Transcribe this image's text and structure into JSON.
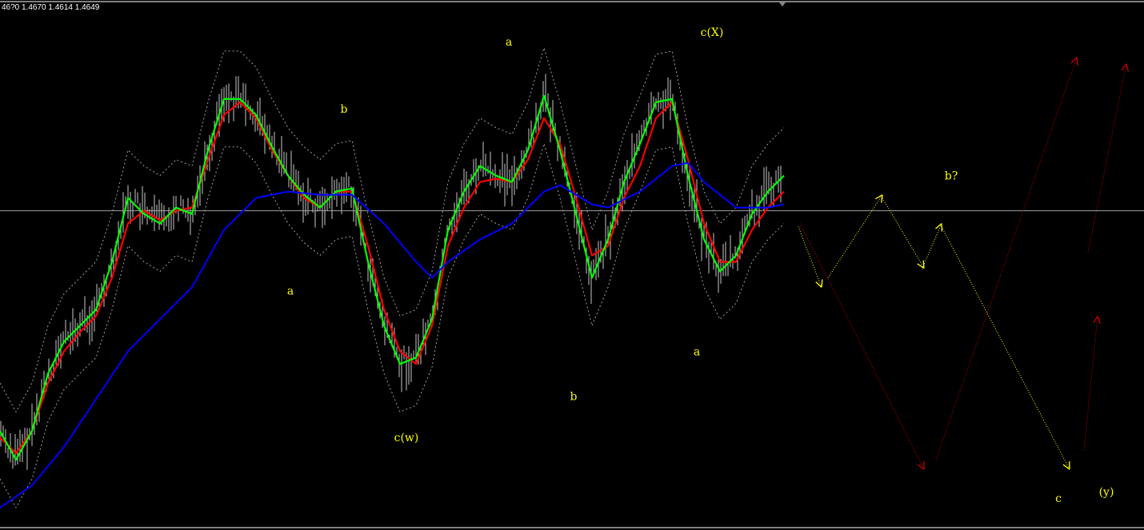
{
  "header": {
    "ohlc_text": "46?0 1.4670 1.4614 1.4649"
  },
  "colors": {
    "background": "#000000",
    "price_bars": "#c8c8c8",
    "fast_ma": "#00ff00",
    "slow_ma": "#ff0000",
    "long_ma": "#0000ff",
    "bands": "#a0a0a0",
    "bid_line": "#a0a0a0",
    "wave_yellow": "#ffff00",
    "wave_red": "#cc0000"
  },
  "chart_data": {
    "type": "line",
    "ylim": [
      1.4549,
      1.4715
    ],
    "bid_line": 1.4649,
    "x_bars": [
      0,
      2,
      4,
      6,
      8,
      10,
      12,
      14,
      16,
      18,
      20,
      22,
      24,
      26,
      28,
      30,
      32,
      34,
      36,
      38,
      40,
      42,
      44,
      46,
      48,
      50,
      52,
      54,
      56,
      58,
      60,
      62,
      64,
      66,
      68,
      70,
      72,
      74,
      76,
      78,
      80,
      82,
      84,
      86,
      88,
      90,
      92,
      94,
      96,
      98
    ],
    "series": [
      {
        "key": "fast",
        "color": "#00ff00",
        "values": [
          1.458,
          1.4571,
          1.458,
          1.4598,
          1.4608,
          1.4613,
          1.4618,
          1.4633,
          1.4653,
          1.4648,
          1.4645,
          1.465,
          1.4648,
          1.4668,
          1.4684,
          1.4684,
          1.4679,
          1.4669,
          1.466,
          1.4654,
          1.465,
          1.4655,
          1.4656,
          1.4633,
          1.4613,
          1.4601,
          1.4603,
          1.4615,
          1.4643,
          1.4655,
          1.4663,
          1.466,
          1.4658,
          1.4668,
          1.4685,
          1.4668,
          1.4648,
          1.4628,
          1.464,
          1.4658,
          1.467,
          1.4683,
          1.4684,
          1.466,
          1.464,
          1.463,
          1.4635,
          1.4648,
          1.4655,
          1.466
        ]
      },
      {
        "key": "slow",
        "color": "#ff0000",
        "values": [
          1.4578,
          1.4573,
          1.458,
          1.4595,
          1.4605,
          1.4611,
          1.4616,
          1.4628,
          1.4645,
          1.4649,
          1.4646,
          1.4649,
          1.465,
          1.4665,
          1.4679,
          1.4683,
          1.4678,
          1.4668,
          1.466,
          1.4653,
          1.465,
          1.4655,
          1.4655,
          1.4638,
          1.4618,
          1.4605,
          1.4601,
          1.4613,
          1.4638,
          1.465,
          1.4658,
          1.4659,
          1.4658,
          1.4665,
          1.4678,
          1.467,
          1.4653,
          1.4635,
          1.4638,
          1.4653,
          1.4663,
          1.4678,
          1.4683,
          1.4665,
          1.4645,
          1.4633,
          1.4633,
          1.4643,
          1.465,
          1.4655
        ]
      },
      {
        "key": "upper",
        "color": "#a0a0a0",
        "dashed": true,
        "values": [
          1.4595,
          1.4586,
          1.4595,
          1.4613,
          1.4623,
          1.4628,
          1.4633,
          1.4648,
          1.4668,
          1.4663,
          1.466,
          1.4665,
          1.4663,
          1.4683,
          1.4699,
          1.4699,
          1.4694,
          1.4684,
          1.4675,
          1.4669,
          1.4665,
          1.467,
          1.4671,
          1.4648,
          1.4628,
          1.4616,
          1.4618,
          1.463,
          1.4658,
          1.467,
          1.4678,
          1.4675,
          1.4673,
          1.4683,
          1.47,
          1.4683,
          1.4663,
          1.4643,
          1.4655,
          1.4673,
          1.4685,
          1.4698,
          1.4699,
          1.4675,
          1.4655,
          1.4645,
          1.465,
          1.4663,
          1.467,
          1.4675
        ]
      },
      {
        "key": "lower",
        "color": "#a0a0a0",
        "dashed": true,
        "values": [
          1.4565,
          1.4556,
          1.4565,
          1.4583,
          1.4593,
          1.4598,
          1.4603,
          1.4618,
          1.4638,
          1.4633,
          1.463,
          1.4635,
          1.4633,
          1.4653,
          1.4669,
          1.4669,
          1.4664,
          1.4654,
          1.4645,
          1.4639,
          1.4635,
          1.464,
          1.4641,
          1.4618,
          1.4598,
          1.4586,
          1.4588,
          1.46,
          1.4628,
          1.464,
          1.4648,
          1.4645,
          1.4643,
          1.4653,
          1.467,
          1.4653,
          1.4633,
          1.4613,
          1.4625,
          1.4643,
          1.4655,
          1.4668,
          1.4669,
          1.4645,
          1.4625,
          1.4615,
          1.462,
          1.4633,
          1.464,
          1.4645
        ]
      }
    ],
    "long_ma": {
      "color": "#0000ff",
      "x_bars": [
        0,
        4,
        8,
        12,
        16,
        20,
        24,
        28,
        32,
        36,
        40,
        44,
        48,
        52,
        54,
        56,
        60,
        64,
        68,
        70,
        74,
        76,
        80,
        84,
        86,
        88,
        92,
        96,
        98
      ],
      "values": [
        1.4556,
        1.4563,
        1.4575,
        1.459,
        1.4605,
        1.4615,
        1.4625,
        1.4643,
        1.4653,
        1.4655,
        1.4654,
        1.4654,
        1.4645,
        1.4633,
        1.4628,
        1.4633,
        1.464,
        1.4645,
        1.4655,
        1.4657,
        1.4651,
        1.465,
        1.4655,
        1.4663,
        1.4664,
        1.4658,
        1.465,
        1.465,
        1.4651
      ]
    },
    "annotations": [
      {
        "text": "b",
        "bar": 43,
        "price": 1.4681
      },
      {
        "text": "a",
        "bar": 36.3,
        "price": 1.4624
      },
      {
        "text": "c(w)",
        "bar": 50.8,
        "price": 1.4578
      },
      {
        "text": "a",
        "bar": 63.6,
        "price": 1.4702
      },
      {
        "text": "b",
        "bar": 71.7,
        "price": 1.4591
      },
      {
        "text": "c(X)",
        "bar": 89,
        "price": 1.4705
      },
      {
        "text": "a",
        "bar": 87.1,
        "price": 1.4605
      },
      {
        "text": "b?",
        "bar": 118.9,
        "price": 1.466
      },
      {
        "text": "c",
        "bar": 132.3,
        "price": 1.4559
      },
      {
        "text": "(y)",
        "bar": 138.3,
        "price": 1.4561
      }
    ],
    "arrows": [
      {
        "color": "#ffff00",
        "from": [
          99.8,
          1.4644
        ],
        "to": [
          102.7,
          1.4625
        ]
      },
      {
        "color": "#ffff00",
        "from": [
          103.5,
          1.4628
        ],
        "to": [
          110.3,
          1.4654
        ]
      },
      {
        "color": "#ffff00",
        "from": [
          110.3,
          1.4653
        ],
        "to": [
          115.5,
          1.4631
        ]
      },
      {
        "color": "#ffff00",
        "from": [
          115.3,
          1.4631
        ],
        "to": [
          117.7,
          1.4645
        ]
      },
      {
        "color": "#ffff00",
        "from": [
          117.7,
          1.4644
        ],
        "to": [
          133.7,
          1.4568
        ]
      },
      {
        "color": "#cc0000",
        "from": [
          100,
          1.4645
        ],
        "to": [
          115.5,
          1.4568
        ]
      },
      {
        "color": "#cc0000",
        "from": [
          117,
          1.4571
        ],
        "to": [
          134.6,
          1.4697
        ]
      },
      {
        "color": "#cc0000",
        "from": [
          136,
          1.4636
        ],
        "to": [
          140.8,
          1.4695
        ]
      },
      {
        "color": "#cc0000",
        "from": [
          135.5,
          1.4574
        ],
        "to": [
          137.2,
          1.4616
        ]
      }
    ]
  }
}
